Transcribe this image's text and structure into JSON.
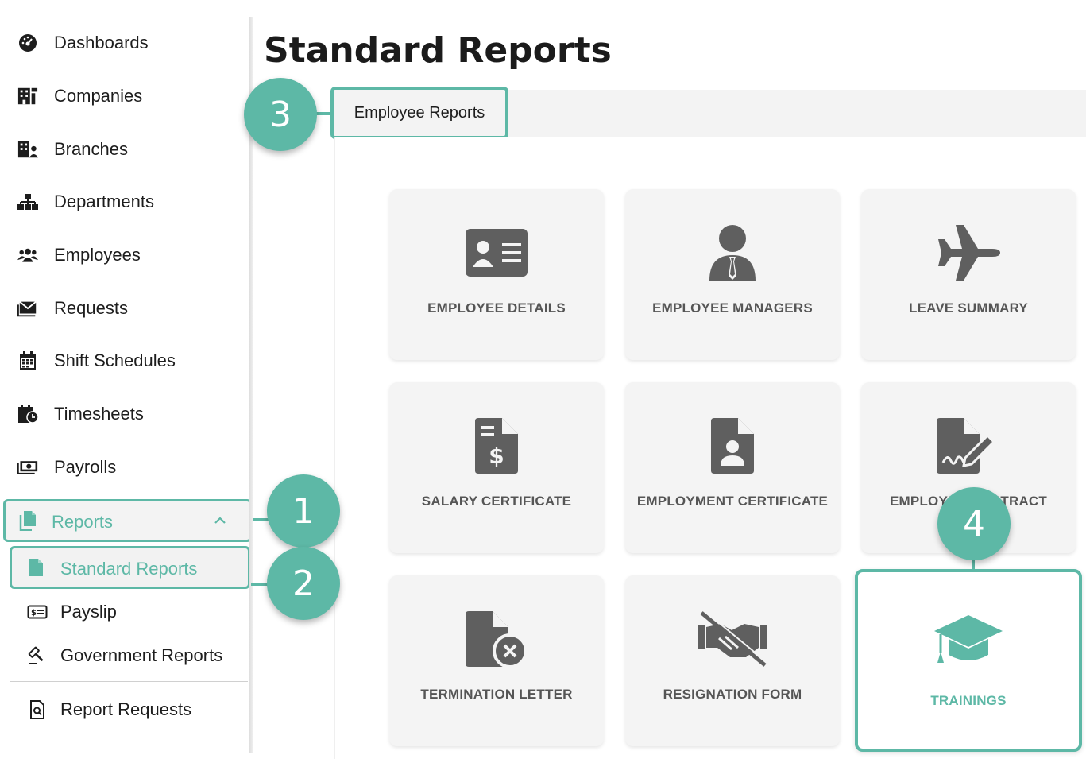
{
  "sidebar": {
    "items": [
      {
        "label": "Dashboards",
        "icon": "gauge-icon"
      },
      {
        "label": "Companies",
        "icon": "building-icon"
      },
      {
        "label": "Branches",
        "icon": "building-user-icon"
      },
      {
        "label": "Departments",
        "icon": "sitemap-icon"
      },
      {
        "label": "Employees",
        "icon": "users-icon"
      },
      {
        "label": "Requests",
        "icon": "envelope-icon"
      },
      {
        "label": "Shift Schedules",
        "icon": "calendar-icon"
      },
      {
        "label": "Timesheets",
        "icon": "calendar-clock-icon"
      },
      {
        "label": "Payrolls",
        "icon": "money-icon"
      }
    ],
    "reports": {
      "label": "Reports",
      "icon": "copy-icon"
    },
    "sub_items": [
      {
        "label": "Standard Reports",
        "icon": "file-icon"
      },
      {
        "label": "Payslip",
        "icon": "money-slip-icon"
      },
      {
        "label": "Government Reports",
        "icon": "gavel-icon"
      }
    ],
    "report_requests": {
      "label": "Report Requests",
      "icon": "file-search-icon"
    }
  },
  "page": {
    "title": "Standard Reports"
  },
  "tabs": {
    "active": "Employee Reports"
  },
  "cards": [
    {
      "label": "EMPLOYEE DETAILS",
      "icon": "id-card-icon"
    },
    {
      "label": "EMPLOYEE MANAGERS",
      "icon": "user-tie-icon"
    },
    {
      "label": "LEAVE SUMMARY",
      "icon": "plane-icon"
    },
    {
      "label": "SALARY CERTIFICATE",
      "icon": "file-invoice-dollar-icon"
    },
    {
      "label": "EMPLOYMENT CERTIFICATE",
      "icon": "file-user-icon"
    },
    {
      "label": "EMPLOYEE CONTRACT",
      "icon": "file-signature-icon"
    },
    {
      "label": "TERMINATION LETTER",
      "icon": "file-x-icon"
    },
    {
      "label": "RESIGNATION FORM",
      "icon": "handshake-slash-icon"
    },
    {
      "label": "TRAININGS",
      "icon": "graduation-cap-icon"
    }
  ],
  "badges": [
    "1",
    "2",
    "3",
    "4"
  ],
  "colors": {
    "accent": "#5db8a6",
    "icon_gray": "#5f5f5f",
    "card_bg": "#f4f4f4"
  }
}
